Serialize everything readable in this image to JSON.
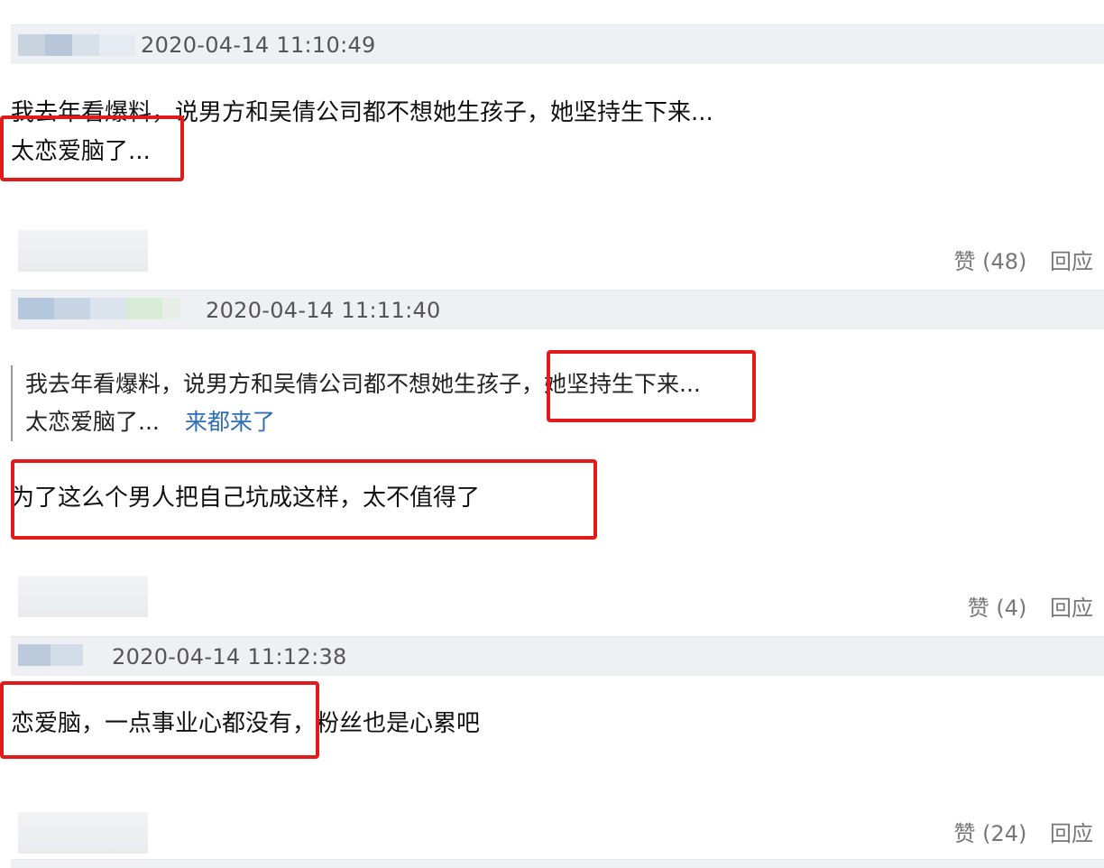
{
  "comments": [
    {
      "timestamp": "2020-04-14 11:10:49",
      "text_line1": "我去年看爆料，说男方和吴倩公司都不想她生孩子，她坚持生下来...",
      "text_line2": "太恋爱脑了...",
      "like_label": "赞 (48)",
      "reply_label": "回应"
    },
    {
      "timestamp": "2020-04-14 11:11:40",
      "quote_line1_part1": "我去年看爆料，说男方和吴倩公司都不想她生孩子，",
      "quote_line1_part2": "她坚持生下来...",
      "quote_line2": "太恋爱脑了...",
      "quote_link": "来都来了",
      "text_line1": "为了这么个男人把自己坑成这样，太不值得了",
      "like_label": "赞 (4)",
      "reply_label": "回应"
    },
    {
      "timestamp": "2020-04-14 11:12:38",
      "text_part1": "恋爱脑，一点事业心都没有",
      "text_part2": "，粉丝也是心累吧",
      "like_label": "赞 (24)",
      "reply_label": "回应"
    }
  ],
  "colors": {
    "highlight_box": "#e21a1a",
    "link": "#2f6db5",
    "header_bg": "#eef0f3"
  }
}
